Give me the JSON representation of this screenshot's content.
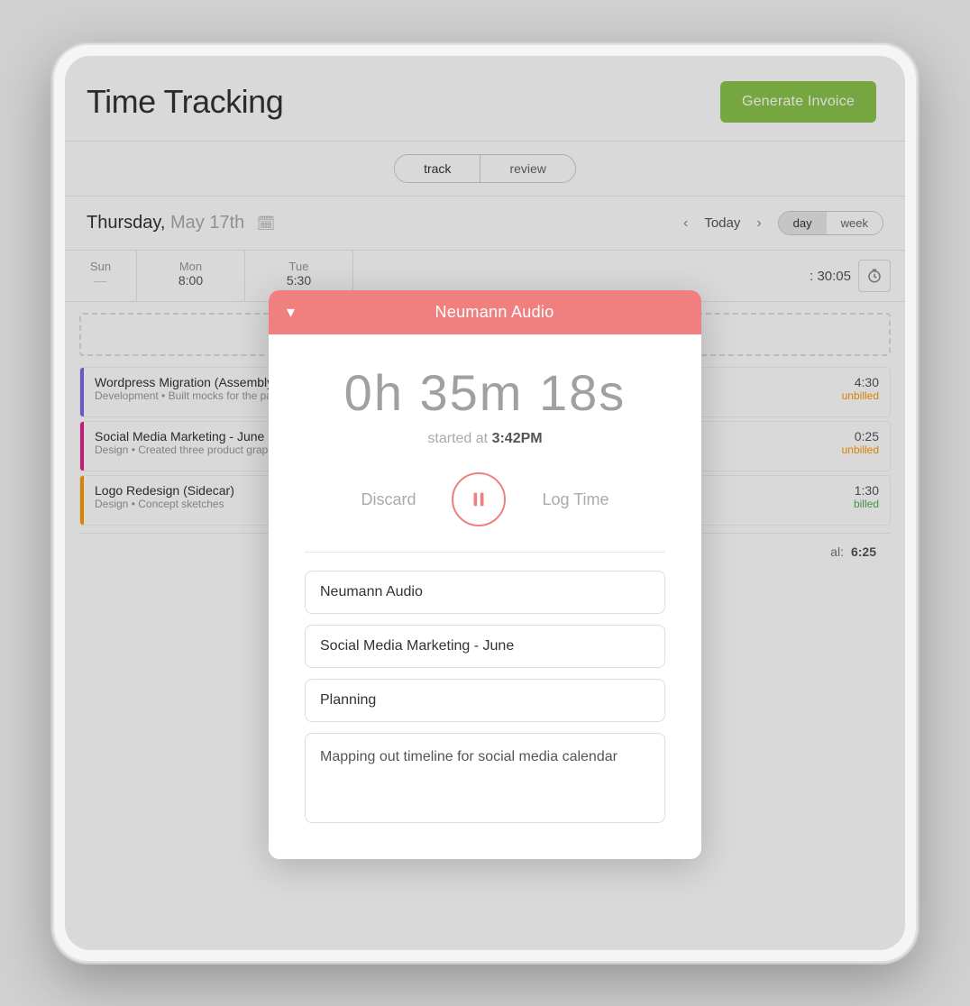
{
  "page": {
    "title": "Time Tracking"
  },
  "header": {
    "title": "Time Tracking",
    "generate_invoice_label": "Generate Invoice"
  },
  "tabs": {
    "track_label": "track",
    "review_label": "review",
    "active": "track"
  },
  "date_nav": {
    "date_label": "Thursday,",
    "date_value": "May 17th",
    "calendar_icon": "📅",
    "prev_arrow": "‹",
    "next_arrow": "›",
    "today_label": "Today",
    "day_view_label": "day",
    "week_view_label": "week",
    "active_view": "day"
  },
  "calendar_days": [
    {
      "name": "Sun",
      "value": "—"
    },
    {
      "name": "Mon",
      "value": "8:00"
    },
    {
      "name": "Tue",
      "value": "5:30"
    }
  ],
  "total_header": ": 30:05",
  "entries": [
    {
      "title": "Wordpress Migration (Assembly Web De",
      "meta": "Development • Built mocks for the payments plug-i",
      "accent": "purple",
      "time": "4:30",
      "status": "unbilled"
    },
    {
      "title": "Social Media Marketing - June (Neuman",
      "meta": "Design • Created three product graphics for June c",
      "accent": "pink",
      "time": "0:25",
      "status": "unbilled"
    },
    {
      "title": "Logo Redesign (Sidecar)",
      "meta": "Design • Concept sketches",
      "accent": "orange",
      "time": "1:30",
      "status": "billed"
    }
  ],
  "total": {
    "label": "al: 6:25"
  },
  "timer_modal": {
    "header_title": "Neumann Audio",
    "chevron": "▾",
    "timer_display": "0h 35m 18s",
    "started_label": "started at",
    "started_time": "3:42PM",
    "discard_label": "Discard",
    "pause_icon": "⏸",
    "log_time_label": "Log Time",
    "client_field": "Neumann Audio",
    "project_field": "Social Media Marketing - June",
    "task_field": "Planning",
    "notes_field": "Mapping out timeline for social media calendar"
  }
}
